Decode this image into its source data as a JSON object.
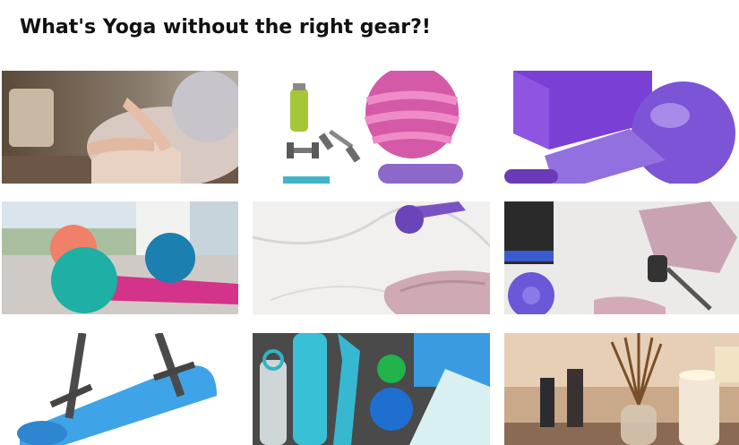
{
  "section": {
    "title": "What's Yoga without the right gear?!"
  },
  "gallery": {
    "images": [
      {
        "alt": "meditation-pose"
      },
      {
        "alt": "fitness-equipment-illustration"
      },
      {
        "alt": "purple-yoga-gear"
      },
      {
        "alt": "exercise-balls-by-window"
      },
      {
        "alt": "dumbbell-and-shoe-on-marble"
      },
      {
        "alt": "yoga-accessories-flatlay"
      },
      {
        "alt": "blue-yoga-mat-with-strap"
      },
      {
        "alt": "teal-fitness-accessories"
      },
      {
        "alt": "candles-and-reed-diffuser"
      }
    ]
  },
  "colors": {
    "heading": "#111111",
    "background": "#ffffff"
  }
}
